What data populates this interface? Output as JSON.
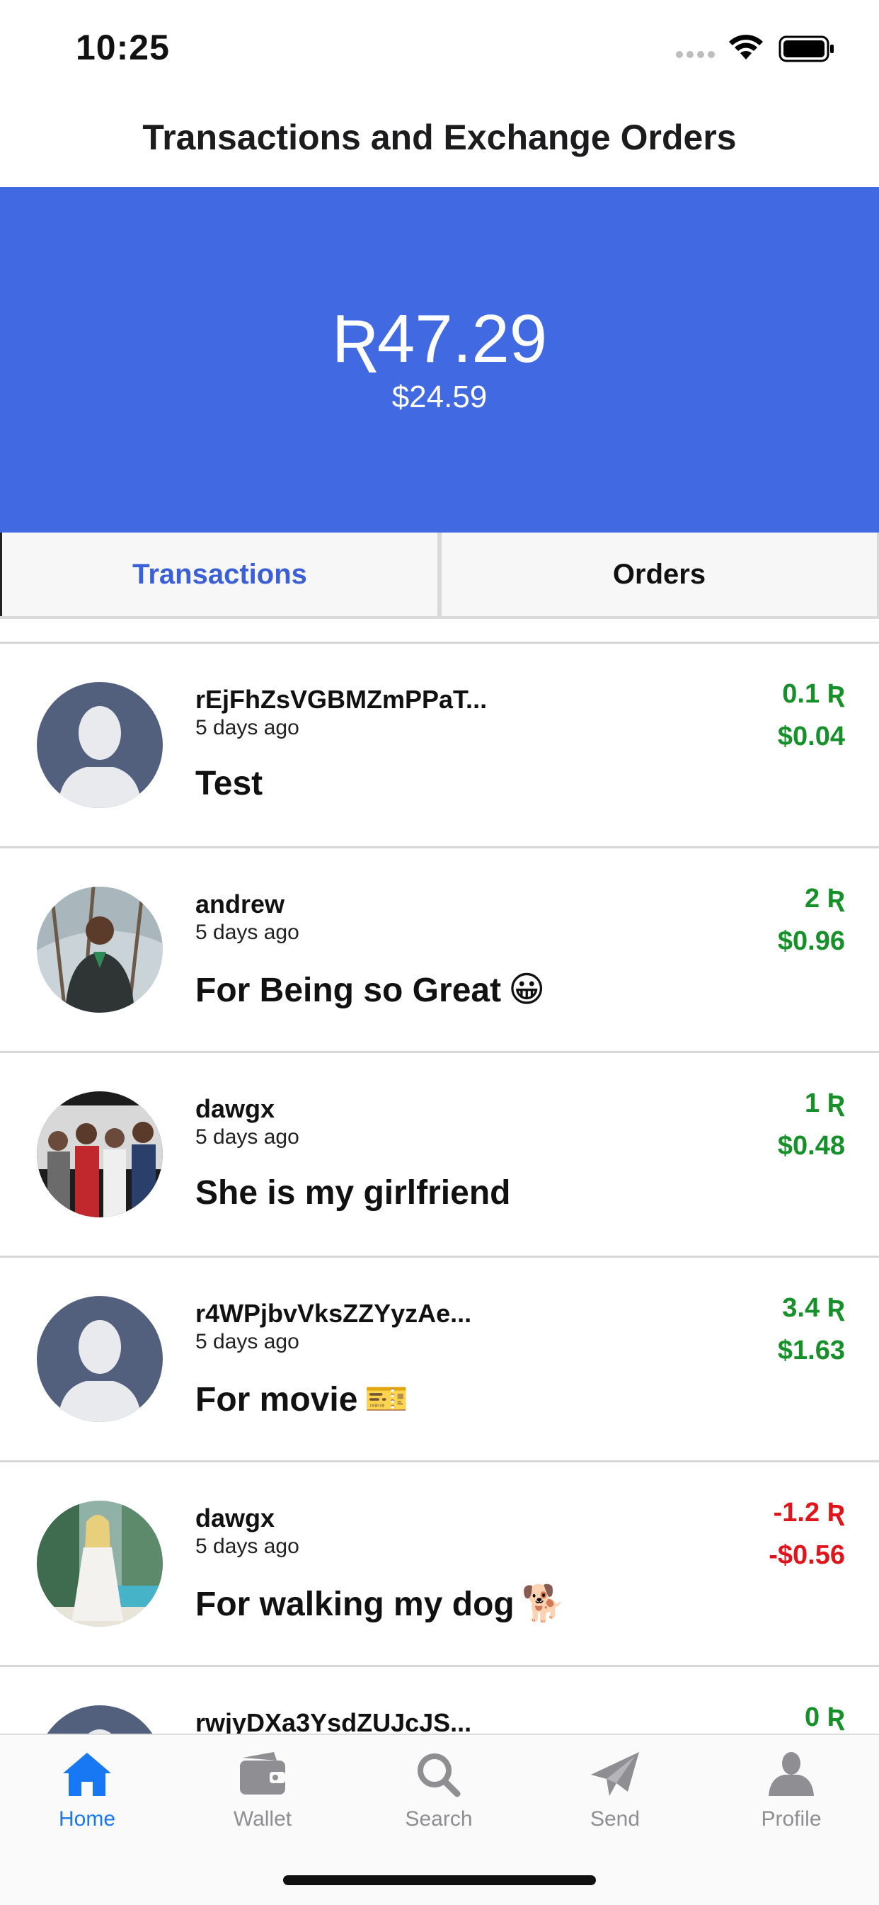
{
  "status_bar": {
    "time": "10:25"
  },
  "header": {
    "title": "Transactions and Exchange Orders"
  },
  "balance": {
    "main": "Ʀ47.29",
    "usd": "$24.59"
  },
  "tabs": [
    {
      "label": "Transactions",
      "active": true
    },
    {
      "label": "Orders",
      "active": false
    }
  ],
  "transactions": [
    {
      "name": "rEjFhZsVGBMZmPPaT...",
      "time": "5 days ago",
      "memo": "Test",
      "emoji": "",
      "amount": "0.1 Ʀ",
      "usd": "$0.04",
      "direction": "in",
      "avatar": "placeholder"
    },
    {
      "name": "andrew",
      "time": "5 days ago",
      "memo": "For Being so Great",
      "emoji": "😀",
      "amount": "2 Ʀ",
      "usd": "$0.96",
      "direction": "in",
      "avatar": "photo-trees"
    },
    {
      "name": "dawgx",
      "time": "5 days ago",
      "memo": "She is my girlfriend",
      "emoji": "",
      "amount": "1 Ʀ",
      "usd": "$0.48",
      "direction": "in",
      "avatar": "photo-group"
    },
    {
      "name": "r4WPjbvVksZZYyzAe...",
      "time": "5 days ago",
      "memo": "For movie",
      "emoji": "🎫",
      "amount": "3.4 Ʀ",
      "usd": "$1.63",
      "direction": "in",
      "avatar": "placeholder"
    },
    {
      "name": "dawgx",
      "time": "5 days ago",
      "memo": "For walking my dog",
      "emoji": "🐕",
      "amount": "-1.2 Ʀ",
      "usd": "-$0.56",
      "direction": "out",
      "avatar": "photo-beach"
    },
    {
      "name": "rwjyDXa3YsdZUJcJS...",
      "time": "",
      "memo": "",
      "emoji": "",
      "amount": "0 Ʀ",
      "usd": "",
      "direction": "in",
      "avatar": "placeholder"
    }
  ],
  "tabbar": [
    {
      "label": "Home",
      "icon": "home-icon",
      "selected": true
    },
    {
      "label": "Wallet",
      "icon": "wallet-icon",
      "selected": false
    },
    {
      "label": "Search",
      "icon": "search-icon",
      "selected": false
    },
    {
      "label": "Send",
      "icon": "send-icon",
      "selected": false
    },
    {
      "label": "Profile",
      "icon": "profile-icon",
      "selected": false
    }
  ],
  "colors": {
    "banner": "#4169e1",
    "positive": "#16912a",
    "negative": "#e0141b",
    "tab_active": "#3b5fd6",
    "tabbar_selected": "#1877f2",
    "tabbar_inactive": "#8e8e93"
  }
}
